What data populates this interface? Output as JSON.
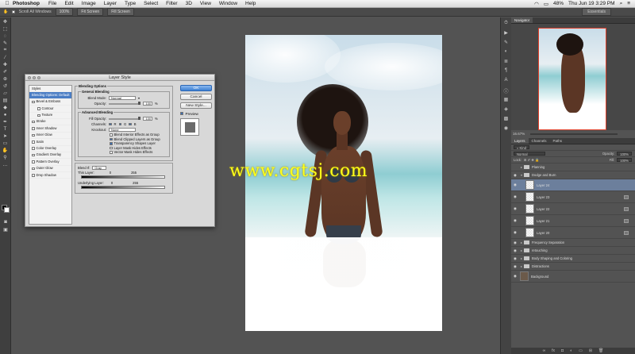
{
  "menubar": {
    "apple": "",
    "app": "Photoshop",
    "items": [
      "File",
      "Edit",
      "Image",
      "Layer",
      "Type",
      "Select",
      "Filter",
      "3D",
      "View",
      "Window",
      "Help"
    ],
    "battery": "48%",
    "clock": "Thu Jun 19  3:29 PM"
  },
  "options": {
    "scroll_all": "Scroll All Windows",
    "btn1": "100%",
    "btn2": "Fit Screen",
    "btn3": "Fill Screen",
    "workspace": "Essentials"
  },
  "watermark": "www.cgtsj.com",
  "dialog": {
    "title": "Layer Style",
    "styles": [
      {
        "label": "Styles",
        "checkbox": false,
        "selected": false,
        "sub": false
      },
      {
        "label": "Blending Options: Default",
        "checkbox": false,
        "selected": true,
        "sub": false
      },
      {
        "label": "Bevel & Emboss",
        "checkbox": true,
        "selected": false,
        "sub": false
      },
      {
        "label": "Contour",
        "checkbox": true,
        "selected": false,
        "sub": true
      },
      {
        "label": "Texture",
        "checkbox": true,
        "selected": false,
        "sub": true
      },
      {
        "label": "Stroke",
        "checkbox": true,
        "selected": false,
        "sub": false
      },
      {
        "label": "Inner Shadow",
        "checkbox": true,
        "selected": false,
        "sub": false
      },
      {
        "label": "Inner Glow",
        "checkbox": true,
        "selected": false,
        "sub": false
      },
      {
        "label": "Satin",
        "checkbox": true,
        "selected": false,
        "sub": false
      },
      {
        "label": "Color Overlay",
        "checkbox": true,
        "selected": false,
        "sub": false
      },
      {
        "label": "Gradient Overlay",
        "checkbox": true,
        "selected": false,
        "sub": false
      },
      {
        "label": "Pattern Overlay",
        "checkbox": true,
        "selected": false,
        "sub": false
      },
      {
        "label": "Outer Glow",
        "checkbox": true,
        "selected": false,
        "sub": false
      },
      {
        "label": "Drop Shadow",
        "checkbox": true,
        "selected": false,
        "sub": false
      }
    ],
    "blending_options": "Blending Options",
    "general_blending": "General Blending",
    "blend_mode_label": "Blend Mode:",
    "blend_mode_value": "Normal",
    "opacity_label": "Opacity:",
    "opacity_value": "100",
    "advanced_blending": "Advanced Blending",
    "fill_opacity_label": "Fill Opacity:",
    "fill_opacity_value": "100",
    "channels_label": "Channels:",
    "channels": [
      "R",
      "G",
      "B"
    ],
    "knockout_label": "Knockout:",
    "knockout_value": "None",
    "checks": [
      {
        "label": "Blend Interior Effects as Group",
        "on": false
      },
      {
        "label": "Blend Clipped Layers as Group",
        "on": true
      },
      {
        "label": "Transparency Shapes Layer",
        "on": true
      },
      {
        "label": "Layer Mask Hides Effects",
        "on": false
      },
      {
        "label": "Vector Mask Hides Effects",
        "on": false
      }
    ],
    "blend_if_label": "Blend If:",
    "blend_if_value": "Gray",
    "this_layer_label": "This Layer:",
    "this_layer_min": "0",
    "this_layer_max": "255",
    "underlying_label": "Underlying Layer:",
    "underlying_min": "0",
    "underlying_max": "255",
    "ok": "OK",
    "cancel": "Cancel",
    "new_style": "New Style...",
    "preview_label": "Preview"
  },
  "navigator": {
    "tab": "Navigator",
    "zoom": "16.67%"
  },
  "layers_panel": {
    "tabs": [
      "Layers",
      "Channels",
      "Paths"
    ],
    "kind": "Kind",
    "blend": "Normal",
    "opacity_label": "Opacity:",
    "opacity_value": "100%",
    "lock_label": "Lock:",
    "fill_label": "Fill:",
    "fill_value": "100%",
    "layers": [
      {
        "name": "Planning",
        "type": "group",
        "selected": false,
        "fx": false,
        "visible": false
      },
      {
        "name": "Dodge and Burn",
        "type": "group-open",
        "selected": false,
        "fx": false,
        "visible": true
      },
      {
        "name": "Layer 24",
        "type": "layer",
        "selected": true,
        "fx": false,
        "visible": true
      },
      {
        "name": "Layer 23",
        "type": "layer",
        "selected": false,
        "fx": true,
        "visible": true
      },
      {
        "name": "Layer 22",
        "type": "layer",
        "selected": false,
        "fx": true,
        "visible": true
      },
      {
        "name": "Layer 21",
        "type": "layer",
        "selected": false,
        "fx": true,
        "visible": true
      },
      {
        "name": "Layer 20",
        "type": "layer",
        "selected": false,
        "fx": true,
        "visible": true
      },
      {
        "name": "Frequency Separation",
        "type": "group",
        "selected": false,
        "fx": false,
        "visible": true
      },
      {
        "name": "retouching",
        "type": "group",
        "selected": false,
        "fx": false,
        "visible": true
      },
      {
        "name": "Body Shaping and Coloring",
        "type": "group",
        "selected": false,
        "fx": false,
        "visible": true
      },
      {
        "name": "Distractions",
        "type": "group",
        "selected": false,
        "fx": false,
        "visible": true
      },
      {
        "name": "Background",
        "type": "background",
        "selected": false,
        "fx": false,
        "visible": true
      }
    ]
  },
  "colors": {
    "panel_bg": "#535353",
    "selection": "#6c7f9c",
    "ok_button": "#3d7fd2",
    "watermark": "#ffff1a"
  }
}
